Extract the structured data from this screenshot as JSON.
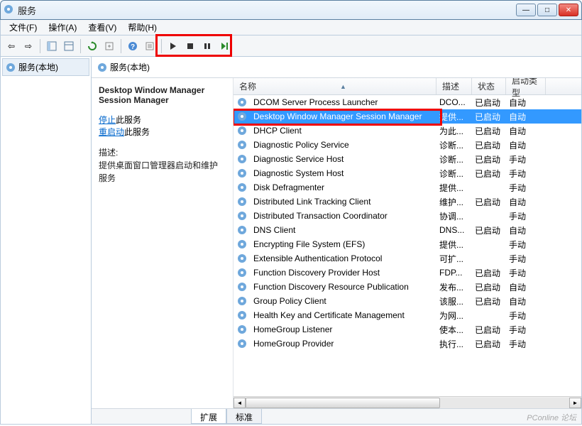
{
  "window": {
    "title": "服务"
  },
  "menu": {
    "file": "文件(F)",
    "action": "操作(A)",
    "view": "查看(V)",
    "help": "帮助(H)"
  },
  "leftpane": {
    "root": "服务(本地)"
  },
  "header": {
    "label": "服务(本地)"
  },
  "detail": {
    "title": "Desktop Window Manager Session Manager",
    "stop_link": "停止",
    "stop_suffix": "此服务",
    "restart_link": "重启动",
    "restart_suffix": "此服务",
    "desc_label": "描述:",
    "desc_text": "提供桌面窗口管理器启动和维护服务"
  },
  "columns": {
    "name": "名称",
    "desc": "描述",
    "status": "状态",
    "start": "启动类型"
  },
  "services": [
    {
      "name": "DCOM Server Process Launcher",
      "desc": "DCO...",
      "status": "已启动",
      "start": "自动",
      "selected": false
    },
    {
      "name": "Desktop Window Manager Session Manager",
      "desc": "提供...",
      "status": "已启动",
      "start": "自动",
      "selected": true
    },
    {
      "name": "DHCP Client",
      "desc": "为此...",
      "status": "已启动",
      "start": "自动",
      "selected": false
    },
    {
      "name": "Diagnostic Policy Service",
      "desc": "诊断...",
      "status": "已启动",
      "start": "自动",
      "selected": false
    },
    {
      "name": "Diagnostic Service Host",
      "desc": "诊断...",
      "status": "已启动",
      "start": "手动",
      "selected": false
    },
    {
      "name": "Diagnostic System Host",
      "desc": "诊断...",
      "status": "已启动",
      "start": "手动",
      "selected": false
    },
    {
      "name": "Disk Defragmenter",
      "desc": "提供...",
      "status": "",
      "start": "手动",
      "selected": false
    },
    {
      "name": "Distributed Link Tracking Client",
      "desc": "维护...",
      "status": "已启动",
      "start": "自动",
      "selected": false
    },
    {
      "name": "Distributed Transaction Coordinator",
      "desc": "协调...",
      "status": "",
      "start": "手动",
      "selected": false
    },
    {
      "name": "DNS Client",
      "desc": "DNS...",
      "status": "已启动",
      "start": "自动",
      "selected": false
    },
    {
      "name": "Encrypting File System (EFS)",
      "desc": "提供...",
      "status": "",
      "start": "手动",
      "selected": false
    },
    {
      "name": "Extensible Authentication Protocol",
      "desc": "可扩...",
      "status": "",
      "start": "手动",
      "selected": false
    },
    {
      "name": "Function Discovery Provider Host",
      "desc": "FDP...",
      "status": "已启动",
      "start": "手动",
      "selected": false
    },
    {
      "name": "Function Discovery Resource Publication",
      "desc": "发布...",
      "status": "已启动",
      "start": "自动",
      "selected": false
    },
    {
      "name": "Group Policy Client",
      "desc": "该服...",
      "status": "已启动",
      "start": "自动",
      "selected": false
    },
    {
      "name": "Health Key and Certificate Management",
      "desc": "为网...",
      "status": "",
      "start": "手动",
      "selected": false
    },
    {
      "name": "HomeGroup Listener",
      "desc": "使本...",
      "status": "已启动",
      "start": "手动",
      "selected": false
    },
    {
      "name": "HomeGroup Provider",
      "desc": "执行...",
      "status": "已启动",
      "start": "手动",
      "selected": false
    }
  ],
  "tabs": {
    "extended": "扩展",
    "standard": "标准"
  },
  "watermark": "PConline 论坛"
}
